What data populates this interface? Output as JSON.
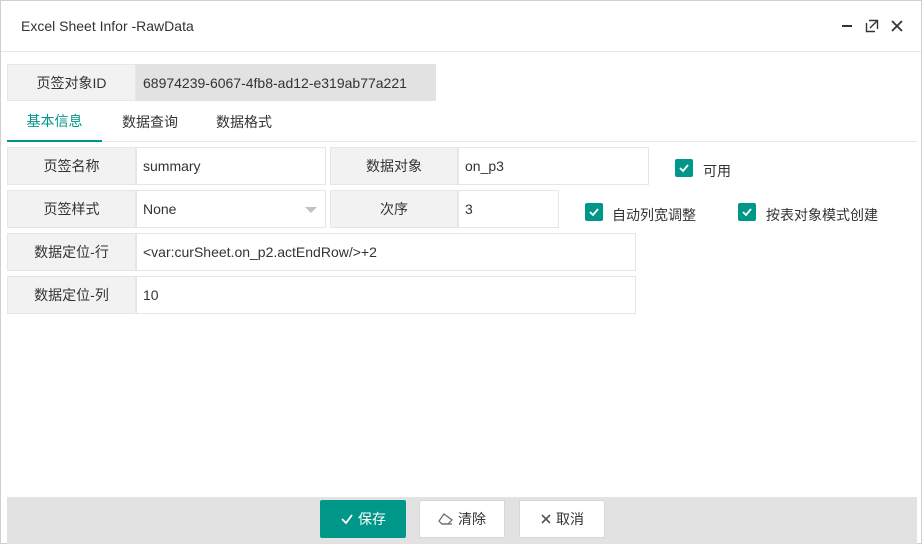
{
  "window": {
    "title": "Excel Sheet Infor -RawData"
  },
  "header_field": {
    "label": "页签对象ID",
    "value": "68974239-6067-4fb8-ad12-e319ab77a221"
  },
  "tabs": [
    {
      "label": "基本信息",
      "active": true
    },
    {
      "label": "数据查询",
      "active": false
    },
    {
      "label": "数据格式",
      "active": false
    }
  ],
  "form": {
    "sheet_name": {
      "label": "页签名称",
      "value": "summary"
    },
    "data_object": {
      "label": "数据对象",
      "value": "on_p3"
    },
    "enabled": {
      "label": "可用",
      "checked": true
    },
    "sheet_style": {
      "label": "页签样式",
      "value": "None"
    },
    "order": {
      "label": "次序",
      "value": "3"
    },
    "auto_width": {
      "label": "自动列宽调整",
      "checked": true
    },
    "create_by_table": {
      "label": "按表对象模式创建",
      "checked": true
    },
    "data_row": {
      "label": "数据定位-行",
      "value": "<var:curSheet.on_p2.actEndRow/>+2"
    },
    "data_col": {
      "label": "数据定位-列",
      "value": "10"
    }
  },
  "footer": {
    "save_label": "保存",
    "clear_label": "清除",
    "cancel_label": "取消"
  },
  "colors": {
    "accent": "#009688",
    "label_bg": "#f2f2f2",
    "footer_bg": "#e2e2e2"
  },
  "icons": {
    "minimize": "minimize-icon",
    "maximize": "maximize-icon",
    "close": "close-icon",
    "check": "check-icon",
    "eraser": "eraser-icon",
    "cancel": "x-icon"
  }
}
